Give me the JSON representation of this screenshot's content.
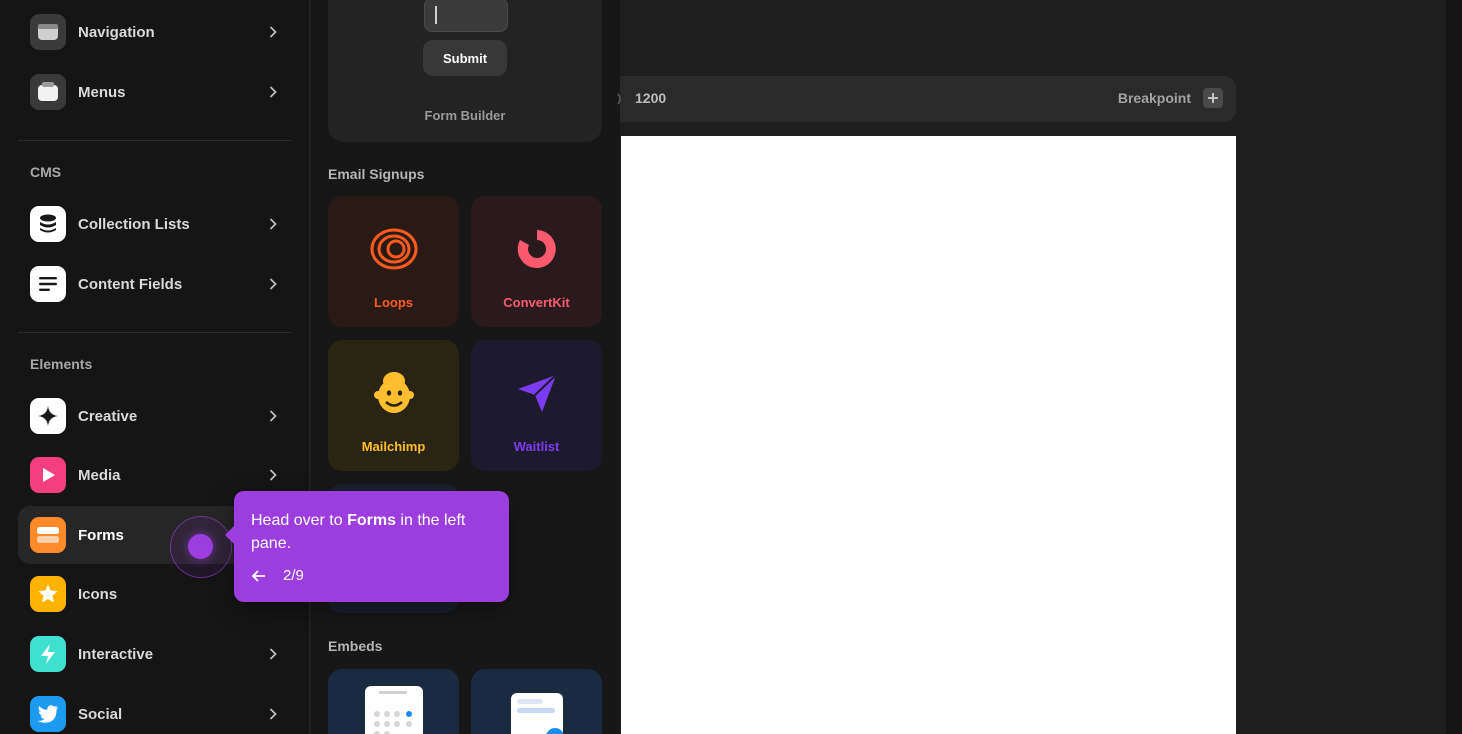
{
  "sidebar": {
    "items_top": [
      {
        "label": "Navigation",
        "icon": "navigation-icon"
      },
      {
        "label": "Menus",
        "icon": "menus-icon"
      }
    ],
    "cms": {
      "title": "CMS",
      "items": [
        {
          "label": "Collection Lists",
          "icon": "database-icon"
        },
        {
          "label": "Content Fields",
          "icon": "text-lines-icon"
        }
      ]
    },
    "elements": {
      "title": "Elements",
      "items": [
        {
          "label": "Creative",
          "icon": "sparkle-icon"
        },
        {
          "label": "Media",
          "icon": "play-icon"
        },
        {
          "label": "Forms",
          "icon": "form-icon",
          "active": true
        },
        {
          "label": "Icons",
          "icon": "star-icon"
        },
        {
          "label": "Interactive",
          "icon": "lightning-icon"
        },
        {
          "label": "Social",
          "icon": "twitter-icon"
        }
      ]
    }
  },
  "panel": {
    "form_builder": {
      "submit_label": "Submit",
      "label": "Form Builder"
    },
    "email_signups": {
      "title": "Email Signups",
      "tiles": [
        {
          "label": "Loops",
          "color": "#ff5a1f"
        },
        {
          "label": "ConvertKit",
          "color": "#fb5a6e"
        },
        {
          "label": "Mailchimp",
          "color": "#ffbe2e"
        },
        {
          "label": "Waitlist",
          "color": "#7b3cf0"
        }
      ]
    },
    "embeds": {
      "title": "Embeds"
    }
  },
  "breakpoint_bar": {
    "width": "1200",
    "label": "Breakpoint"
  },
  "tooltip": {
    "text_before": "Head over to ",
    "text_bold": "Forms",
    "text_after": " in the left pane.",
    "step": "2/9"
  },
  "colors": {
    "accent": "#9b3ddf",
    "background": "#1e1e1e",
    "canvas": "#ffffff"
  }
}
